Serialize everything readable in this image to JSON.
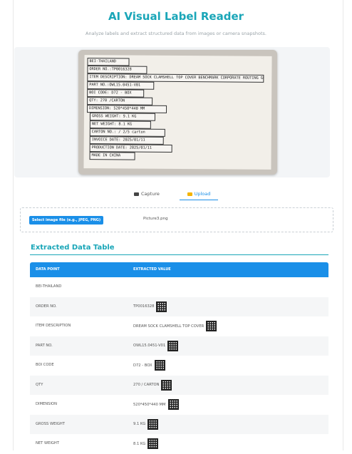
{
  "header": {
    "title": "AI Visual Label Reader",
    "subtitle": "Analyze labels and extract structured data from images or camera snapshots."
  },
  "label_image": {
    "lines": [
      "BEI-THAILAND",
      "ORDER NO.:TP0016328",
      "ITEM DESCRIPTION: DREAM SOCK CLAMSHELL TOP COVER BENCHMARK CORPORATE ROUTING GU",
      "PART NO.:OWL15.0451-V01",
      "BOI CODE: D72 - BOX",
      "QTY: 270 /CARTON",
      "DIMENSION: 520*450*440 MM",
      "GROSS WEIGHT: 9.1 KG",
      "NET WEIGHT: 8.1 KG",
      "CARTON NO.: / 2/5 carton",
      "INVOICE DATE: 2025/01/11",
      "PRODUCTION DATE: 2025/01/11",
      "MADE IN CHINA"
    ]
  },
  "tabs": [
    {
      "label": "Capture",
      "icon": "camera-icon"
    },
    {
      "label": "Upload",
      "icon": "folder-icon",
      "active": true
    }
  ],
  "upload": {
    "button_label": "Select image file (e.g., JPEG, PNG)",
    "file_name": "Picture3.png"
  },
  "table": {
    "section_title": "Extracted Data Table",
    "headers": [
      "DATA POINT",
      "EXTRACTED VALUE"
    ],
    "rows": [
      {
        "point": "BEI-THAILAND",
        "value": "",
        "qr": false
      },
      {
        "point": "ORDER NO.",
        "value": "TP0016328",
        "qr": true
      },
      {
        "point": "ITEM DESCRIPTION",
        "value": "DREAM SOCK CLAMSHELL TOP COVER",
        "qr": true
      },
      {
        "point": "PART NO.",
        "value": "OWL15.0451-V01",
        "qr": true
      },
      {
        "point": "BOI CODE",
        "value": "D72 - BOX",
        "qr": true
      },
      {
        "point": "QTY",
        "value": "270 / CARTON",
        "qr": true
      },
      {
        "point": "DIMENSION",
        "value": "520*450*440 MM",
        "qr": true
      },
      {
        "point": "GROSS WEIGHT",
        "value": "9.1 KG",
        "qr": true
      },
      {
        "point": "NET WEIGHT",
        "value": "8.1 KG",
        "qr": true
      }
    ]
  },
  "colors": {
    "accent": "#1aa6b8",
    "primary": "#1a8fe8"
  }
}
